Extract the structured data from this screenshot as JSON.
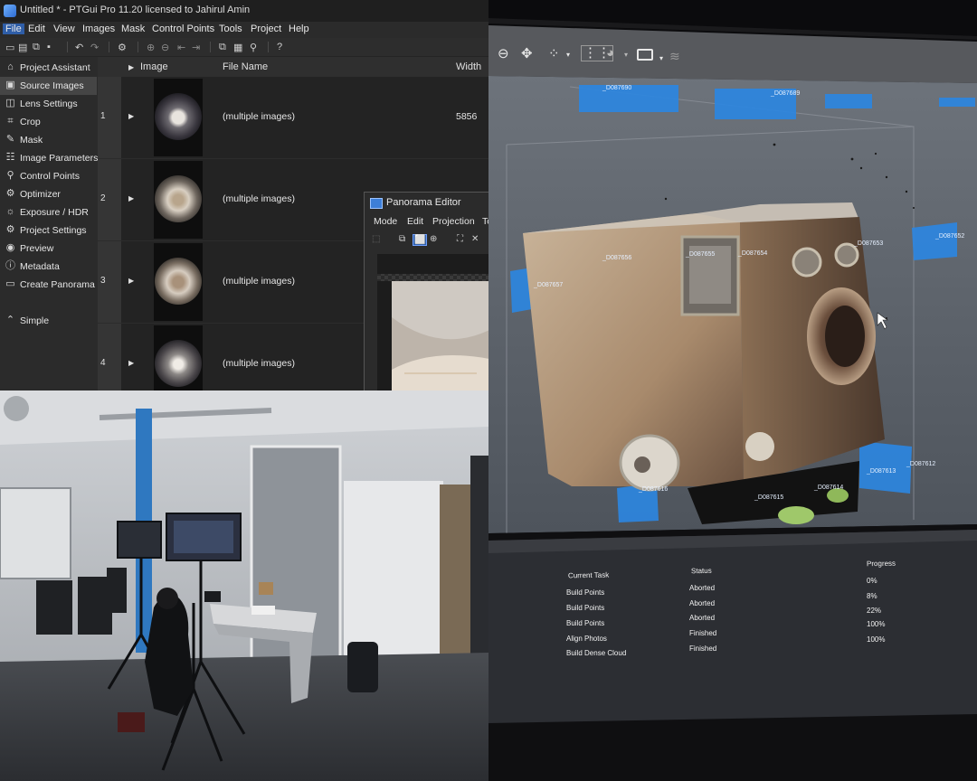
{
  "ptgui": {
    "title": "Untitled * - PTGui Pro 11.20 licensed to Jahirul Amin",
    "menu": [
      "File",
      "Edit",
      "View",
      "Images",
      "Mask",
      "Control Points",
      "Tools",
      "Project",
      "Help"
    ],
    "sidebar": [
      {
        "label": "Project Assistant",
        "icon": "house-icon",
        "glyph": "⌂"
      },
      {
        "label": "Source Images",
        "icon": "image-icon",
        "glyph": "▣"
      },
      {
        "label": "Lens Settings",
        "icon": "lens-icon",
        "glyph": "◫"
      },
      {
        "label": "Crop",
        "icon": "crop-icon",
        "glyph": "⌗"
      },
      {
        "label": "Mask",
        "icon": "brush-icon",
        "glyph": "✎"
      },
      {
        "label": "Image Parameters",
        "icon": "sliders-icon",
        "glyph": "☷"
      },
      {
        "label": "Control Points",
        "icon": "control-points-icon",
        "glyph": "⚲"
      },
      {
        "label": "Optimizer",
        "icon": "optimizer-icon",
        "glyph": "⚙"
      },
      {
        "label": "Exposure / HDR",
        "icon": "sun-icon",
        "glyph": "☼"
      },
      {
        "label": "Project Settings",
        "icon": "gear-icon",
        "glyph": "⚙"
      },
      {
        "label": "Preview",
        "icon": "eye-icon",
        "glyph": "◉"
      },
      {
        "label": "Metadata",
        "icon": "info-icon",
        "glyph": "ⓘ"
      },
      {
        "label": "Create Panorama",
        "icon": "panorama-icon",
        "glyph": "▭"
      }
    ],
    "simple_label": "Simple",
    "columns": {
      "image": "Image",
      "file_name": "File Name",
      "width": "Width"
    },
    "rows": [
      {
        "index": "1",
        "file_name": "(multiple images)",
        "width": "5856"
      },
      {
        "index": "2",
        "file_name": "(multiple images)",
        "width": ""
      },
      {
        "index": "3",
        "file_name": "(multiple images)",
        "width": ""
      },
      {
        "index": "4",
        "file_name": "(multiple images)",
        "width": ""
      }
    ],
    "panorama_editor": {
      "title": "Panorama Editor",
      "menu": [
        "Mode",
        "Edit",
        "Projection",
        "To"
      ]
    }
  },
  "metashape": {
    "camera_labels": [
      "_D087656",
      "_D087655",
      "_D087654",
      "_D087653",
      "_D087652",
      "_D087657",
      "_D087616",
      "_D087615",
      "_D087614",
      "_D087613",
      "_D087612",
      "_D087690",
      "_D087689"
    ],
    "tasks": {
      "headers": {
        "task": "Current Task",
        "status": "Status",
        "progress": "Progress"
      },
      "rows": [
        {
          "task": "Build Points",
          "status": "Aborted",
          "progress": "0%"
        },
        {
          "task": "Build Points",
          "status": "Aborted",
          "progress": "8%"
        },
        {
          "task": "Build Points",
          "status": "Aborted",
          "progress": "22%"
        },
        {
          "task": "Align Photos",
          "status": "Finished",
          "progress": "100%"
        },
        {
          "task": "Build Dense Cloud",
          "status": "Finished",
          "progress": "100%"
        }
      ]
    }
  }
}
